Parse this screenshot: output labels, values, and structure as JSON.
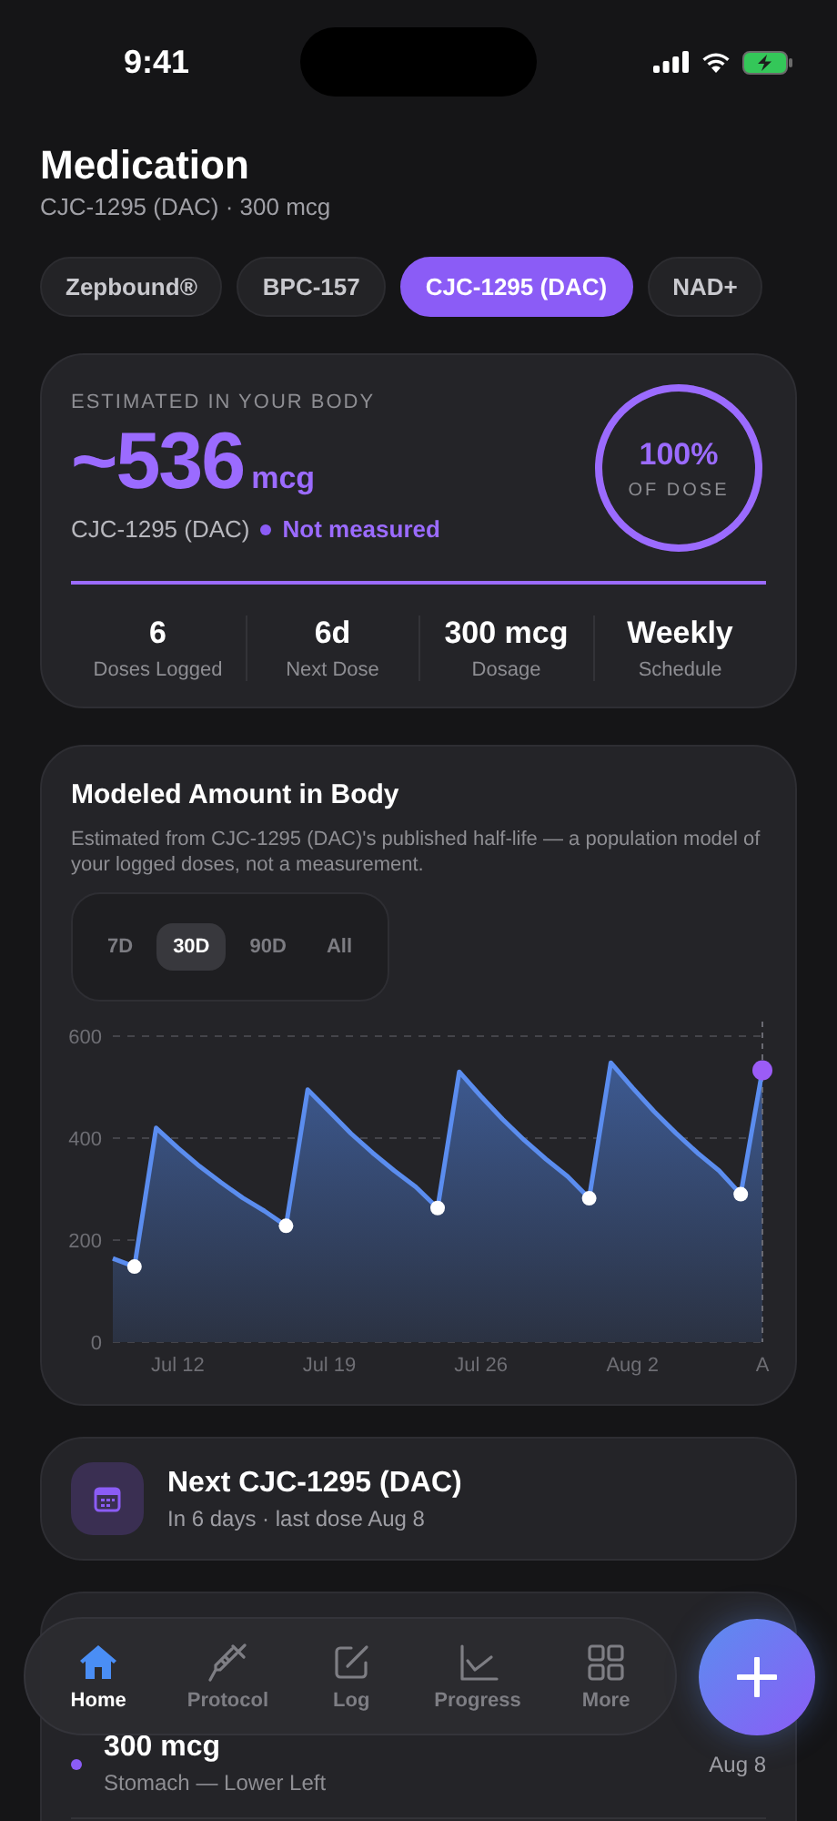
{
  "status_bar": {
    "time": "9:41"
  },
  "header": {
    "title": "Medication",
    "subtitle": "CJC-1295 (DAC) · 300 mcg"
  },
  "medications": [
    {
      "label": "Zepbound®",
      "selected": false
    },
    {
      "label": "BPC-157",
      "selected": false
    },
    {
      "label": "CJC-1295 (DAC)",
      "selected": true
    },
    {
      "label": "NAD+",
      "selected": false
    }
  ],
  "estimate": {
    "caption": "ESTIMATED IN YOUR BODY",
    "amount": "~536",
    "unit": "mcg",
    "name": "CJC-1295 (DAC)",
    "status": "Not measured",
    "ring": {
      "value": "100%",
      "caption": "OF DOSE",
      "level": 1
    },
    "bar": {
      "level": 1
    },
    "stats": [
      {
        "value": "6",
        "label": "Doses Logged"
      },
      {
        "value": "6d",
        "label": "Next Dose"
      },
      {
        "value": "300 mcg",
        "label": "Dosage"
      },
      {
        "value": "Weekly",
        "label": "Schedule"
      }
    ]
  },
  "chart_card": {
    "title": "Modeled Amount in Body",
    "description": "Estimated from CJC-1295 (DAC)'s published half-life — a population model of your logged doses, not a measurement.",
    "ranges": [
      {
        "label": "7D",
        "selected": false
      },
      {
        "label": "30D",
        "selected": true
      },
      {
        "label": "90D",
        "selected": false
      },
      {
        "label": "All",
        "selected": false
      }
    ],
    "chart_data": {
      "type": "area",
      "categories": [
        null,
        null,
        null,
        "Jul 12",
        null,
        null,
        null,
        null,
        null,
        null,
        "Jul 19",
        null,
        null,
        null,
        null,
        null,
        null,
        "Jul 26",
        null,
        null,
        null,
        null,
        null,
        null,
        "Aug 2",
        null,
        null,
        null,
        null,
        null,
        "A"
      ],
      "series": [
        {
          "color": "#5b8def",
          "values": [
            164,
            148,
            420,
            381,
            345,
            313,
            283,
            257,
            228,
            495,
            452,
            409,
            371,
            336,
            304,
            263,
            530,
            482,
            437,
            396,
            359,
            325,
            282,
            548,
            499,
            452,
            410,
            371,
            336,
            290,
            533
          ]
        }
      ],
      "ylim": [
        0,
        600
      ],
      "yticks": [
        0,
        200,
        400,
        600
      ]
    }
  },
  "next_dose": {
    "title": "Next CJC-1295 (DAC)",
    "subtitle": "In 6 days · last dose Aug 8"
  },
  "history": [
    {
      "amount": "300 mcg",
      "site": "Stomach — Lower Left",
      "date": "Aug 8",
      "color": "#8b5cf6"
    }
  ],
  "nav": [
    {
      "label": "Home",
      "selected": true
    },
    {
      "label": "Protocol",
      "selected": false
    },
    {
      "label": "Log",
      "selected": false
    },
    {
      "label": "Progress",
      "selected": false
    },
    {
      "label": "More",
      "selected": false
    }
  ]
}
